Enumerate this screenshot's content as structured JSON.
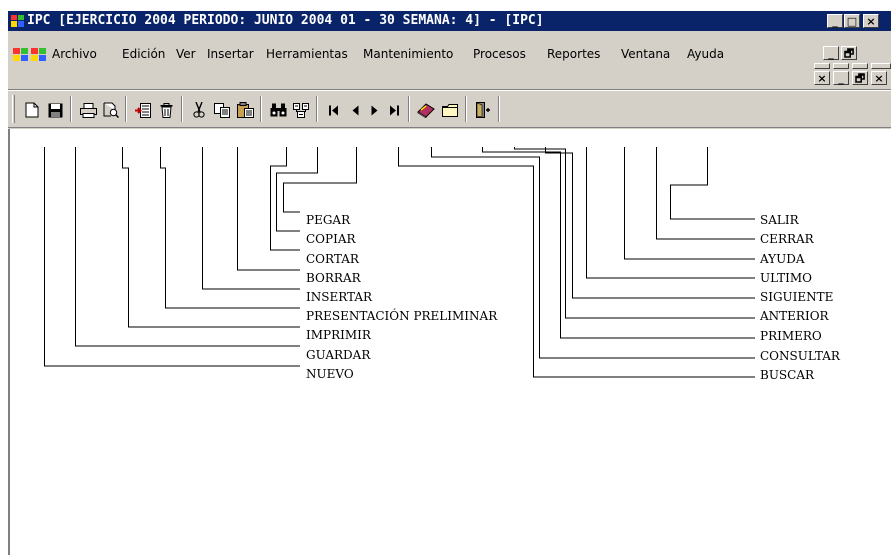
{
  "window": {
    "title": "IPC [EJERCICIO 2004 PERIODO: JUNIO 2004 01 - 30 SEMANA: 4] - [IPC]"
  },
  "caption_buttons": {
    "minimize": "_",
    "maximize": "□",
    "close": "×",
    "restore": "🗗"
  },
  "menu": {
    "items": [
      "Archivo",
      "Edición",
      "Ver",
      "Insertar",
      "Herramientas",
      "Mantenimiento",
      "Procesos",
      "Reportes",
      "Ventana",
      "Ayuda"
    ]
  },
  "toolbar": {
    "buttons": [
      {
        "icon": "new-document-icon"
      },
      {
        "icon": "save-disk-icon"
      },
      {
        "icon": "printer-icon"
      },
      {
        "icon": "print-preview-icon"
      },
      {
        "icon": "insert-record-icon"
      },
      {
        "icon": "trash-icon"
      },
      {
        "icon": "scissors-icon"
      },
      {
        "icon": "copy-icon"
      },
      {
        "icon": "paste-icon"
      },
      {
        "icon": "binoculars-icon"
      },
      {
        "icon": "query-icon"
      },
      {
        "icon": "first-record-icon"
      },
      {
        "icon": "previous-record-icon"
      },
      {
        "icon": "next-record-icon"
      },
      {
        "icon": "last-record-icon"
      },
      {
        "icon": "help-book-icon"
      },
      {
        "icon": "close-folder-icon"
      },
      {
        "icon": "exit-door-icon"
      }
    ]
  },
  "legend": {
    "left": [
      "PEGAR",
      "COPIAR",
      "CORTAR",
      "BORRAR",
      "INSERTAR",
      "PRESENTACIÓN PRELIMINAR",
      "IMPRIMIR",
      "GUARDAR",
      "NUEVO"
    ],
    "right": [
      "SALIR",
      "CERRAR",
      "AYUDA",
      "ULTIMO",
      "SIGUIENTE",
      "ANTERIOR",
      "PRIMERO",
      "CONSULTAR",
      "BUSCAR"
    ]
  },
  "colors": {
    "titlebar": "#0a246a",
    "face": "#d4d0c8",
    "title_text": "#ffffff"
  }
}
